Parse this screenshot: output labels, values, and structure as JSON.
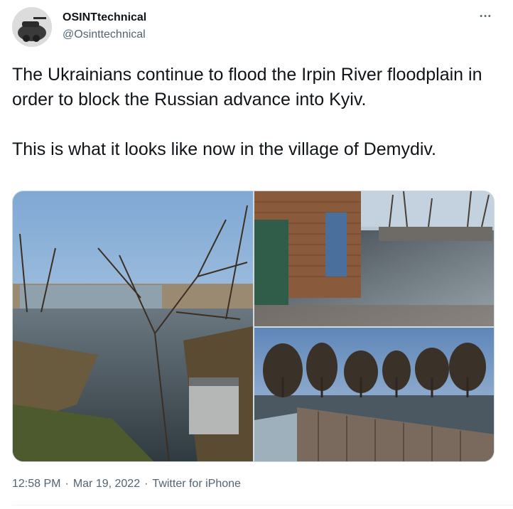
{
  "author": {
    "display_name": "OSINTtechnical",
    "handle": "@Osinttechnical"
  },
  "tweet": {
    "text": "The Ukrainians continue to flood the Irpin River floodplain in order to block the Russian advance into Kyiv.\n\nThis is what it looks like now in the village of Demydiv.",
    "time": "12:58 PM",
    "sep1": "·",
    "date": "Mar 19, 2022",
    "sep2": "·",
    "source": "Twitter for iPhone"
  },
  "more_button": {
    "icon": "more-horizontal-icon",
    "glyph": "•••"
  },
  "media": {
    "photos": [
      {
        "icon": "photo-flooded-yard-trees"
      },
      {
        "icon": "photo-flooded-courtyard-brick-wall"
      },
      {
        "icon": "photo-flooded-field-fence-trees"
      }
    ]
  },
  "colors": {
    "text_primary": "#0f1419",
    "text_secondary": "#536471",
    "border": "#cfd9de"
  }
}
